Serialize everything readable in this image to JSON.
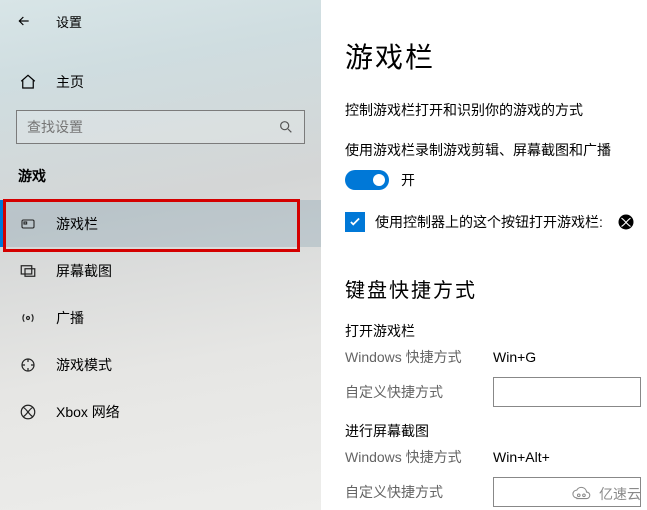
{
  "header": {
    "settings_label": "设置"
  },
  "sidebar": {
    "home_label": "主页",
    "search_placeholder": "查找设置",
    "category_label": "游戏",
    "items": [
      {
        "label": "游戏栏"
      },
      {
        "label": "屏幕截图"
      },
      {
        "label": "广播"
      },
      {
        "label": "游戏模式"
      },
      {
        "label": "Xbox 网络"
      }
    ]
  },
  "main": {
    "title": "游戏栏",
    "description": "控制游戏栏打开和识别你的游戏的方式",
    "record_line": "使用游戏栏录制游戏剪辑、屏幕截图和广播",
    "toggle_label": "开",
    "controller_label": "使用控制器上的这个按钮打开游戏栏:",
    "shortcuts_heading": "键盘快捷方式",
    "open_gamebar_title": "打开游戏栏",
    "win_shortcut_label": "Windows 快捷方式",
    "custom_shortcut_label": "自定义快捷方式",
    "open_gamebar_shortcut": "Win+G",
    "screenshot_title": "进行屏幕截图",
    "screenshot_shortcut": "Win+Alt+"
  },
  "watermark": "亿速云"
}
